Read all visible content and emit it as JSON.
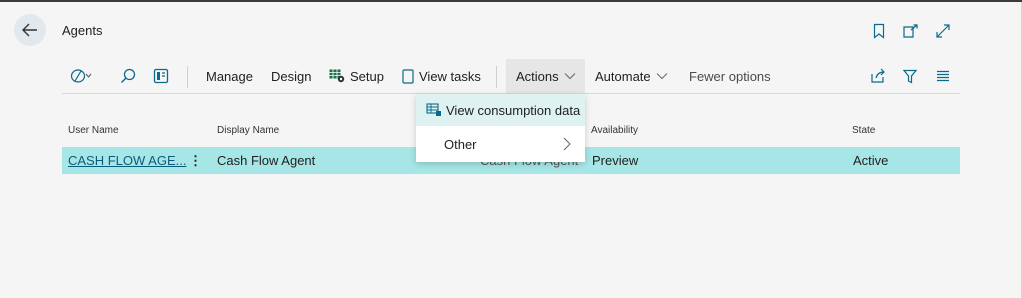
{
  "header": {
    "title": "Agents"
  },
  "toolbar": {
    "manage": "Manage",
    "design": "Design",
    "setup": "Setup",
    "view_tasks": "View tasks",
    "actions": "Actions",
    "automate": "Automate",
    "fewer_options": "Fewer options"
  },
  "actions_menu": {
    "items": [
      {
        "label": "View consumption data",
        "icon": "table-icon"
      },
      {
        "label": "Other",
        "icon": "chevron-right-icon"
      }
    ]
  },
  "table": {
    "columns": {
      "user_name": "User Name",
      "display_name": "Display Name",
      "availability": "Availability",
      "state": "State"
    },
    "rows": [
      {
        "user_name": "CASH FLOW AGE...",
        "display_name": "Cash Flow Agent",
        "hidden_partial": "Cash Flow Agent",
        "availability": "Preview",
        "state": "Active"
      }
    ]
  },
  "colors": {
    "selected_row": "#a6e6e6",
    "link": "#0b5c7a",
    "page_bg": "#f5f5f5"
  }
}
